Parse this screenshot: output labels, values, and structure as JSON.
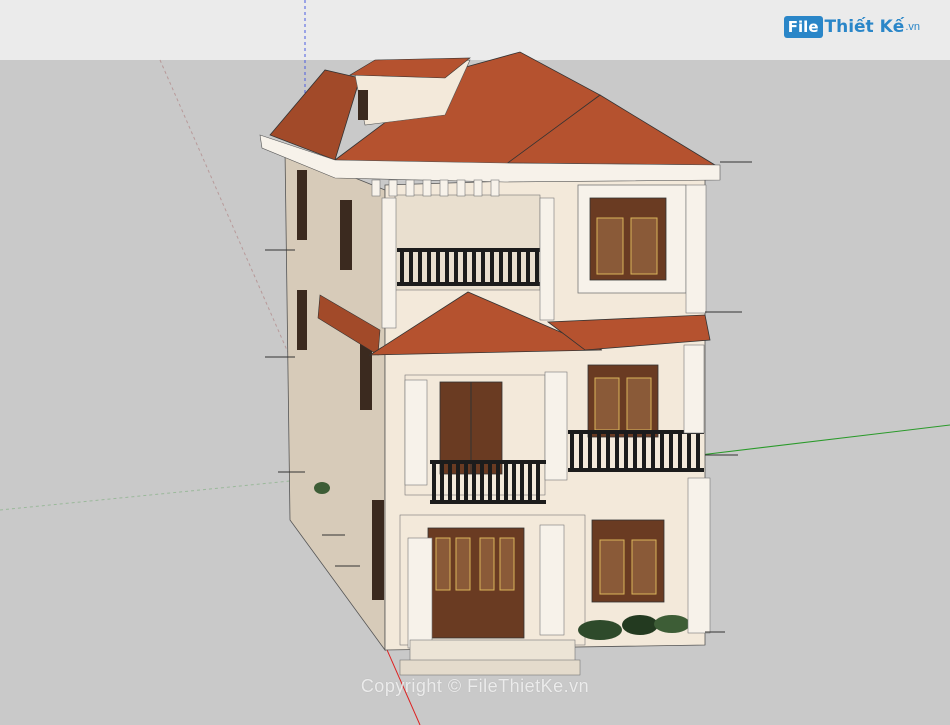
{
  "logo": {
    "badge": "File",
    "text": "Thiết Kế",
    "tld": ".vn"
  },
  "watermark": "Copyright © FileThietKe.vn",
  "colors": {
    "sky": "#ebebeb",
    "ground": "#c9c9c9",
    "roof": "#b5522f",
    "roof_shadow": "#8f3b1f",
    "wall": "#f3e9da",
    "wall_shadow": "#d7cbb9",
    "trim": "#f7f2ea",
    "door": "#6a3b22",
    "railing": "#1c1c1c",
    "axis_red": "#d22",
    "axis_green": "#2a9a2a",
    "axis_blue": "#4a5be0"
  },
  "icons": [
    "file-thiet-ke-logo-icon",
    "house-model-icon"
  ]
}
